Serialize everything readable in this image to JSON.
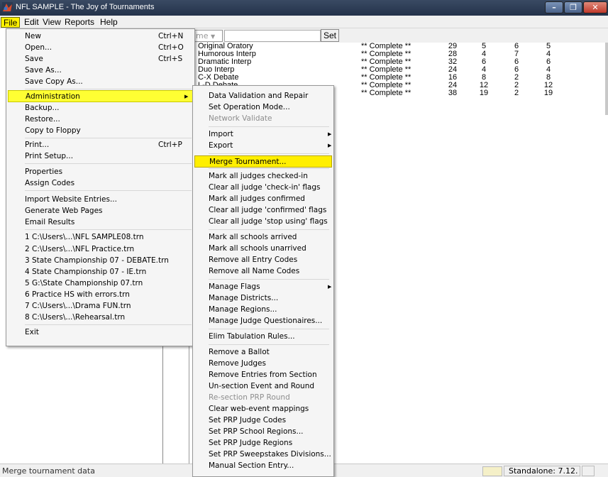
{
  "window": {
    "title": "NFL SAMPLE - The Joy of Tournaments"
  },
  "menubar": {
    "items": [
      "File",
      "Edit",
      "View",
      "Reports",
      "Help"
    ]
  },
  "toolbar": {
    "combo_value": "ime",
    "set_label": "Set"
  },
  "events": [
    {
      "name": "Original Oratory",
      "status": "** Complete **",
      "n1": "29",
      "n2": "5",
      "n3": "6",
      "n4": "5"
    },
    {
      "name": "Humorous Interp",
      "status": "** Complete **",
      "n1": "28",
      "n2": "4",
      "n3": "7",
      "n4": "4"
    },
    {
      "name": "Dramatic Interp",
      "status": "** Complete **",
      "n1": "32",
      "n2": "6",
      "n3": "6",
      "n4": "6"
    },
    {
      "name": "Duo Interp",
      "status": "** Complete **",
      "n1": "24",
      "n2": "4",
      "n3": "6",
      "n4": "4"
    },
    {
      "name": "C-X Debate",
      "status": "** Complete **",
      "n1": "16",
      "n2": "8",
      "n3": "2",
      "n4": "8"
    },
    {
      "name": "L-D Debate",
      "status": "** Complete **",
      "n1": "24",
      "n2": "12",
      "n3": "2",
      "n4": "12"
    },
    {
      "name": "",
      "status": "** Complete **",
      "n1": "38",
      "n2": "19",
      "n3": "2",
      "n4": "19"
    }
  ],
  "file_menu": {
    "items": [
      {
        "label": "New",
        "shortcut": "Ctrl+N"
      },
      {
        "label": "Open...",
        "shortcut": "Ctrl+O"
      },
      {
        "label": "Save",
        "shortcut": "Ctrl+S"
      },
      {
        "label": "Save As...",
        "shortcut": ""
      },
      {
        "label": "Save Copy As...",
        "shortcut": ""
      },
      {
        "label": "Administration",
        "shortcut": ""
      },
      {
        "label": "Backup...",
        "shortcut": ""
      },
      {
        "label": "Restore...",
        "shortcut": ""
      },
      {
        "label": "Copy to Floppy",
        "shortcut": ""
      },
      {
        "label": "Print...",
        "shortcut": "Ctrl+P"
      },
      {
        "label": "Print Setup...",
        "shortcut": ""
      },
      {
        "label": "Properties",
        "shortcut": ""
      },
      {
        "label": "Assign Codes",
        "shortcut": ""
      },
      {
        "label": "Import Website Entries...",
        "shortcut": ""
      },
      {
        "label": "Generate Web Pages",
        "shortcut": ""
      },
      {
        "label": "Email Results",
        "shortcut": ""
      },
      {
        "label": "1 C:\\Users\\...\\NFL SAMPLE08.trn",
        "shortcut": ""
      },
      {
        "label": "2 C:\\Users\\...\\NFL Practice.trn",
        "shortcut": ""
      },
      {
        "label": "3 State Championship 07 - DEBATE.trn",
        "shortcut": ""
      },
      {
        "label": "4 State Championship 07 - IE.trn",
        "shortcut": ""
      },
      {
        "label": "5 G:\\State Championship 07.trn",
        "shortcut": ""
      },
      {
        "label": "6 Practice HS with errors.trn",
        "shortcut": ""
      },
      {
        "label": "7 C:\\Users\\...\\Drama FUN.trn",
        "shortcut": ""
      },
      {
        "label": "8 C:\\Users\\...\\Rehearsal.trn",
        "shortcut": ""
      },
      {
        "label": "Exit",
        "shortcut": ""
      }
    ]
  },
  "admin_menu": {
    "items": [
      {
        "label": "Data Validation and Repair"
      },
      {
        "label": "Set Operation Mode..."
      },
      {
        "label": "Network Validate",
        "disabled": true
      },
      {
        "label": "Import"
      },
      {
        "label": "Export"
      },
      {
        "label": "Merge Tournament..."
      },
      {
        "label": "Mark all judges checked-in"
      },
      {
        "label": "Clear all judge 'check-in' flags"
      },
      {
        "label": "Mark all judges confirmed"
      },
      {
        "label": "Clear all judge 'confirmed' flags"
      },
      {
        "label": "Clear all judge 'stop using' flags"
      },
      {
        "label": "Mark all schools arrived"
      },
      {
        "label": "Mark all schools unarrived"
      },
      {
        "label": "Remove all Entry Codes"
      },
      {
        "label": "Remove all Name Codes"
      },
      {
        "label": "Manage Flags"
      },
      {
        "label": "Manage Districts..."
      },
      {
        "label": "Manage Regions..."
      },
      {
        "label": "Manage Judge Questionaires..."
      },
      {
        "label": "Elim Tabulation Rules..."
      },
      {
        "label": "Remove a Ballot"
      },
      {
        "label": "Remove Judges"
      },
      {
        "label": "Remove Entries from Section"
      },
      {
        "label": "Un-section Event and Round"
      },
      {
        "label": "Re-section PRP Round",
        "disabled": true
      },
      {
        "label": "Clear web-event mappings"
      },
      {
        "label": "Set PRP Judge Codes"
      },
      {
        "label": "Set PRP School Regions..."
      },
      {
        "label": "Set PRP Judge Regions"
      },
      {
        "label": "Set PRP Sweepstakes Divisions..."
      },
      {
        "label": "Manual Section Entry..."
      }
    ]
  },
  "statusbar": {
    "message": "Merge tournament data",
    "version": "Standalone: 7.12."
  },
  "colors": {
    "highlight": "#ffff33",
    "titlebar": "#2c3a52"
  }
}
